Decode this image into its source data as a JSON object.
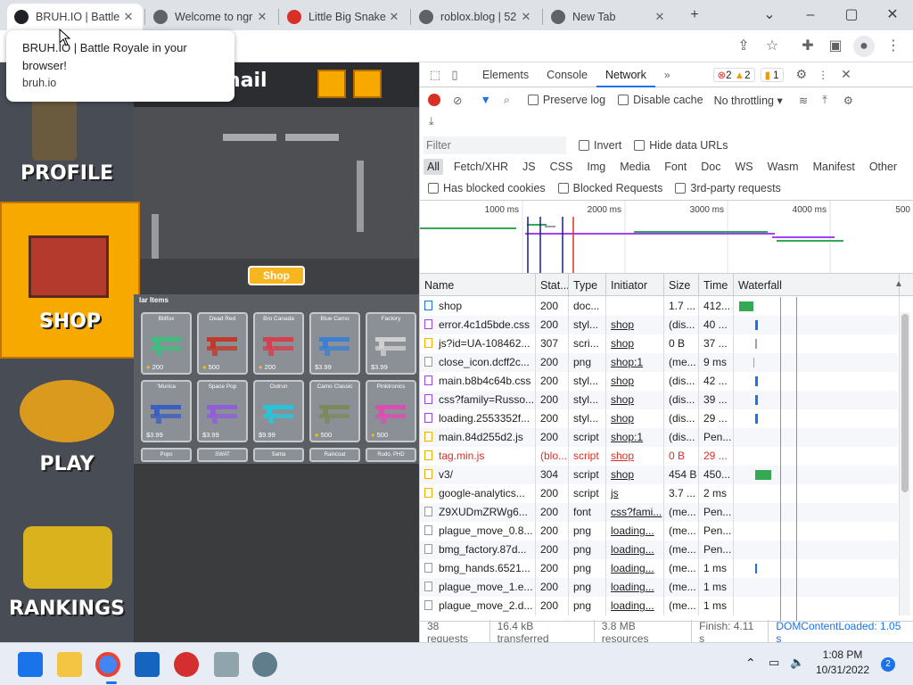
{
  "browser": {
    "tabs": [
      {
        "title": "BRUH.IO | Battle Royale in your browser!",
        "short": "BRUH.IO | Battle",
        "color": "#202124"
      },
      {
        "title": "Welcome to ngrok",
        "short": "Welcome to ngr",
        "color": "#5f6368"
      },
      {
        "title": "Little Big Snake",
        "short": "Little Big Snake",
        "color": "#d93025"
      },
      {
        "title": "roblox.blog | 52",
        "short": "roblox.blog | 52",
        "color": "#5f6368"
      },
      {
        "title": "New Tab",
        "short": "New Tab",
        "color": "#5f6368"
      }
    ],
    "tooltip": {
      "title": "BRUH.IO | Battle Royale in your browser!",
      "host": "bruh.io"
    }
  },
  "game": {
    "header_fragment": "nail",
    "nav": [
      {
        "label": "PROFILE"
      },
      {
        "label": "SHOP"
      },
      {
        "label": "PLAY"
      },
      {
        "label": "RANKINGS"
      }
    ],
    "shop_button": "Shop",
    "section_label": "lar Items",
    "items": [
      {
        "name": "Blitfox",
        "price": "200",
        "coin": true,
        "color": "#3fbf7f"
      },
      {
        "name": "Dead Red",
        "price": "500",
        "coin": true,
        "color": "#c0392b"
      },
      {
        "name": "Bro Canada",
        "price": "200",
        "coin": true,
        "color": "#d63f4e"
      },
      {
        "name": "Blue Camo",
        "price": "$3.99",
        "coin": false,
        "color": "#3d7fd1"
      },
      {
        "name": "Factory",
        "price": "$3.99",
        "coin": false,
        "color": "#cfcfcf"
      },
      {
        "name": "'Murica",
        "price": "$3.99",
        "coin": false,
        "color": "#3b5fc0"
      },
      {
        "name": "Space Pop",
        "price": "$3.99",
        "coin": false,
        "color": "#8e5fd6"
      },
      {
        "name": "Outrun",
        "price": "$9.99",
        "coin": false,
        "color": "#27c5d9"
      },
      {
        "name": "Camo Classic",
        "price": "500",
        "coin": true,
        "color": "#7a8a5a"
      },
      {
        "name": "Pinktronics",
        "price": "500",
        "coin": true,
        "color": "#d94fb0"
      }
    ],
    "more_items": [
      "Popo",
      "SWAT",
      "Santa",
      "Raincoat",
      "Rudo, PHD"
    ]
  },
  "devtools": {
    "tabs": [
      "Elements",
      "Console",
      "Network"
    ],
    "selected_tab": "Network",
    "badges": {
      "errors": "2",
      "warnings": "2",
      "issues": "1"
    },
    "toolbar": {
      "preserve_log": "Preserve log",
      "disable_cache": "Disable cache",
      "throttling": "No throttling"
    },
    "filter": {
      "placeholder": "Filter",
      "invert": "Invert",
      "hide_data": "Hide data URLs"
    },
    "types": [
      "All",
      "Fetch/XHR",
      "JS",
      "CSS",
      "Img",
      "Media",
      "Font",
      "Doc",
      "WS",
      "Wasm",
      "Manifest",
      "Other"
    ],
    "checks": {
      "blocked_cookies": "Has blocked cookies",
      "blocked_requests": "Blocked Requests",
      "third_party": "3rd-party requests"
    },
    "timeline_ticks": [
      "1000 ms",
      "2000 ms",
      "3000 ms",
      "4000 ms",
      "500"
    ],
    "columns": [
      "Name",
      "Stat...",
      "Type",
      "Initiator",
      "Size",
      "Time",
      "Waterfall"
    ],
    "rows": [
      {
        "name": "shop",
        "status": "200",
        "type": "doc...",
        "initiator": "",
        "size": "1.7 ...",
        "time": "412...",
        "err": false
      },
      {
        "name": "error.4c1d5bde.css",
        "status": "200",
        "type": "styl...",
        "initiator": "shop",
        "size": "(dis...",
        "time": "40 ...",
        "err": false
      },
      {
        "name": "js?id=UA-108462...",
        "status": "307",
        "type": "scri...",
        "initiator": "shop",
        "size": "0 B",
        "time": "37 ...",
        "err": false
      },
      {
        "name": "close_icon.dcff2c...",
        "status": "200",
        "type": "png",
        "initiator": "shop:1",
        "size": "(me...",
        "time": "9 ms",
        "err": false
      },
      {
        "name": "main.b8b4c64b.css",
        "status": "200",
        "type": "styl...",
        "initiator": "shop",
        "size": "(dis...",
        "time": "42 ...",
        "err": false
      },
      {
        "name": "css?family=Russo...",
        "status": "200",
        "type": "styl...",
        "initiator": "shop",
        "size": "(dis...",
        "time": "39 ...",
        "err": false
      },
      {
        "name": "loading.2553352f...",
        "status": "200",
        "type": "styl...",
        "initiator": "shop",
        "size": "(dis...",
        "time": "29 ...",
        "err": false
      },
      {
        "name": "main.84d255d2.js",
        "status": "200",
        "type": "script",
        "initiator": "shop:1",
        "size": "(dis...",
        "time": "Pen...",
        "err": false
      },
      {
        "name": "tag.min.js",
        "status": "(blo...",
        "type": "script",
        "initiator": "shop",
        "size": "0 B",
        "time": "29 ...",
        "err": true
      },
      {
        "name": "v3/",
        "status": "304",
        "type": "script",
        "initiator": "shop",
        "size": "454 B",
        "time": "450...",
        "err": false
      },
      {
        "name": "google-analytics...",
        "status": "200",
        "type": "script",
        "initiator": "js",
        "size": "3.7 ...",
        "time": "2 ms",
        "err": false
      },
      {
        "name": "Z9XUDmZRWg6...",
        "status": "200",
        "type": "font",
        "initiator": "css?fami...",
        "size": "(me...",
        "time": "Pen...",
        "err": false
      },
      {
        "name": "plague_move_0.8...",
        "status": "200",
        "type": "png",
        "initiator": "loading...",
        "size": "(me...",
        "time": "Pen...",
        "err": false
      },
      {
        "name": "bmg_factory.87d...",
        "status": "200",
        "type": "png",
        "initiator": "loading...",
        "size": "(me...",
        "time": "Pen...",
        "err": false
      },
      {
        "name": "bmg_hands.6521...",
        "status": "200",
        "type": "png",
        "initiator": "loading...",
        "size": "(me...",
        "time": "1 ms",
        "err": false
      },
      {
        "name": "plague_move_1.e...",
        "status": "200",
        "type": "png",
        "initiator": "loading...",
        "size": "(me...",
        "time": "1 ms",
        "err": false
      },
      {
        "name": "plague_move_2.d...",
        "status": "200",
        "type": "png",
        "initiator": "loading...",
        "size": "(me...",
        "time": "1 ms",
        "err": false
      }
    ],
    "status": {
      "requests": "38 requests",
      "transferred": "16.4 kB transferred",
      "resources": "3.8 MB resources",
      "finish": "Finish: 4.11 s",
      "dcl": "DOMContentLoaded: 1.05 s"
    }
  },
  "taskbar": {
    "time": "1:08 PM",
    "date": "10/31/2022",
    "notifications": "2"
  }
}
